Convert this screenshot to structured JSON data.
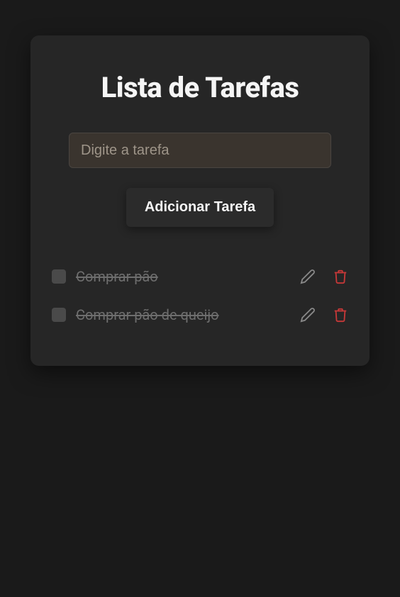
{
  "title": "Lista de Tarefas",
  "input": {
    "placeholder": "Digite a tarefa",
    "value": ""
  },
  "addButton": {
    "label": "Adicionar Tarefa"
  },
  "tasks": [
    {
      "text": "Comprar pão",
      "completed": true
    },
    {
      "text": "Comprar pão de queijo",
      "completed": true
    }
  ]
}
